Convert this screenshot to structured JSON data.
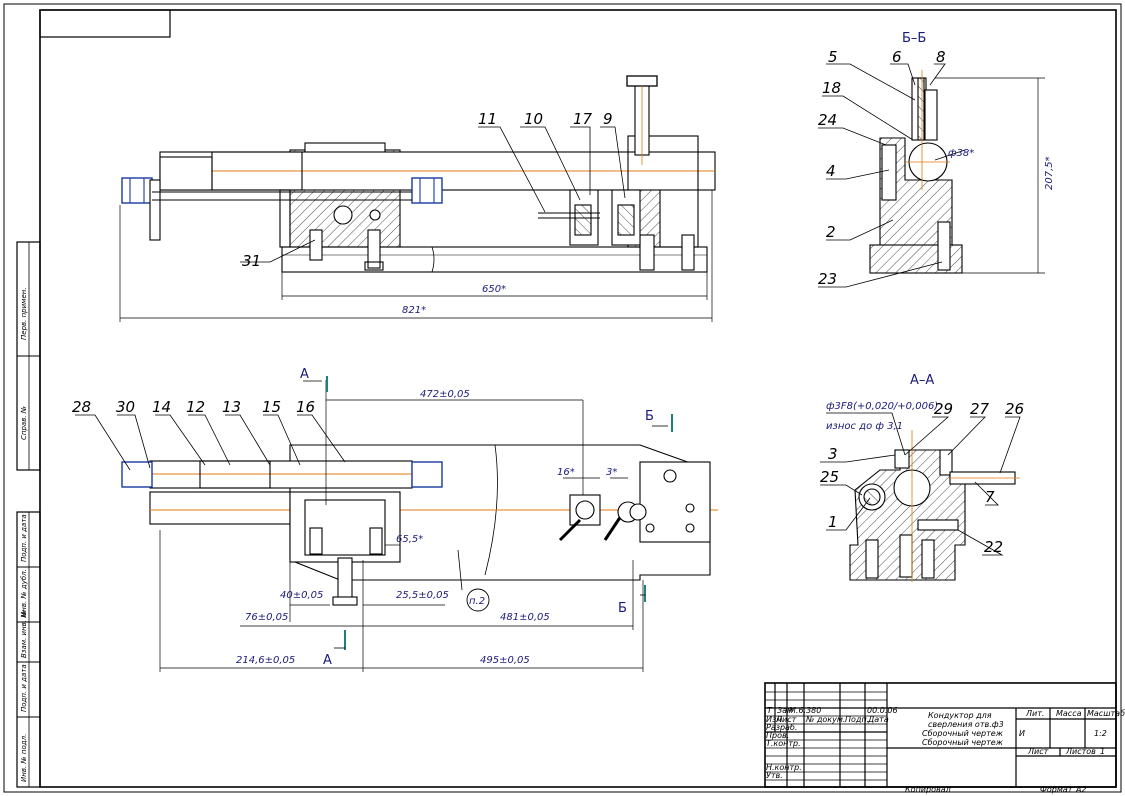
{
  "section_titles": {
    "bb": "Б–Б",
    "aa": "А–А"
  },
  "cut_letters": {
    "a_top": "А",
    "a_bottom": "А",
    "b_top": "Б",
    "b_bottom": "Б"
  },
  "front_view": {
    "dims": {
      "d650": "650*",
      "d821": "821*"
    },
    "callouts": [
      "31",
      "11",
      "10",
      "17",
      "9"
    ]
  },
  "plan_view": {
    "dims": {
      "d472": "472±0,05",
      "d16": "16*",
      "d3": "3*",
      "d655": "65,5*",
      "d40": "40±0,05",
      "d255": "25,5±0,05",
      "d76": "76±0,05",
      "d481": "481±0,05",
      "d2146": "214,6±0,05",
      "d495": "495±0,05",
      "p2": "п.2"
    },
    "callouts": [
      "28",
      "30",
      "14",
      "12",
      "13",
      "15",
      "16"
    ]
  },
  "section_bb": {
    "dims": {
      "d38": "ф38*",
      "d2075": "207,5*"
    },
    "callouts": [
      "5",
      "6",
      "8",
      "18",
      "24",
      "4",
      "2",
      "23"
    ]
  },
  "section_aa": {
    "fit_label": "ф3F8(+0,020/+0,006)",
    "wear_label": "износ до ф 3,1",
    "callouts": [
      "29",
      "27",
      "26",
      "3",
      "25",
      "7",
      "1",
      "22"
    ]
  },
  "title_block": {
    "rev_row": [
      "Т",
      "Зам",
      "М.6.380",
      "",
      "",
      "00.0.06"
    ],
    "header_row": [
      "Изм",
      "Лист",
      "№ докум.",
      "Подп.",
      "Дата"
    ],
    "roles": [
      "Разраб.",
      "Пров.",
      "Т.контр.",
      "",
      "Н.контр.",
      "Утв."
    ],
    "title_lines": [
      "Кондуктор для",
      "сверления отв.ф3",
      "Сборочный чертеж",
      "Сборочный чертеж"
    ],
    "lit_label": "Лит.",
    "mass_label": "Масса",
    "scale_label": "Масштаб",
    "scale_value": "1:2",
    "lit_value": "И",
    "sheet_label": "Лист",
    "sheets_label": "Листов",
    "sheets_value": "1",
    "copied_label": "Копировал",
    "format_label": "Формат",
    "format_value": "А2"
  },
  "side_stamp": [
    "Перв. примен.",
    "Справ. №",
    "Подп. и дата",
    "Инв. № дубл.",
    "Взам. инв. №",
    "Подп. и дата",
    "Инв. № подл."
  ]
}
